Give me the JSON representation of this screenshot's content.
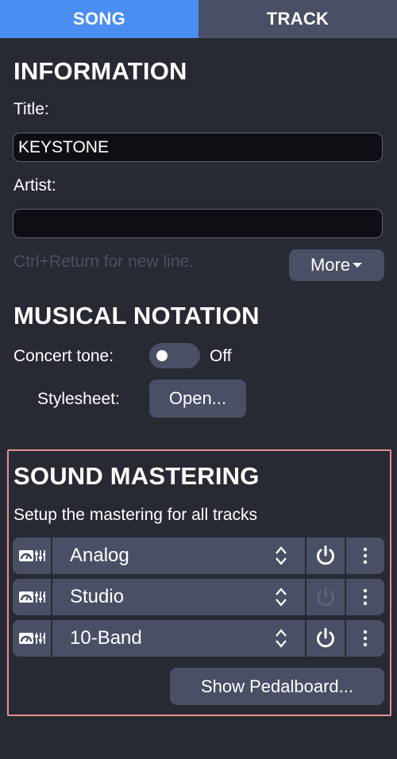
{
  "tabs": [
    {
      "label": "SONG",
      "active": true
    },
    {
      "label": "TRACK",
      "active": false
    }
  ],
  "information": {
    "heading": "INFORMATION",
    "title_label": "Title:",
    "title_value": "KEYSTONE",
    "artist_label": "Artist:",
    "artist_value": "",
    "hint": "Ctrl+Return for new line.",
    "more_label": "More"
  },
  "notation": {
    "heading": "MUSICAL NOTATION",
    "concert_tone_label": "Concert tone:",
    "concert_tone_state": "Off",
    "stylesheet_label": "Stylesheet:",
    "open_label": "Open..."
  },
  "mastering": {
    "heading": "SOUND MASTERING",
    "description": "Setup the mastering for all tracks",
    "chains": [
      {
        "name": "Analog",
        "enabled": true
      },
      {
        "name": "Studio",
        "enabled": false
      },
      {
        "name": "10-Band",
        "enabled": true
      }
    ],
    "pedalboard_label": "Show Pedalboard..."
  },
  "colors": {
    "background": "#272a33",
    "accent": "#4b8ef2",
    "control": "#4a4f65",
    "highlight_border": "#e58f92"
  },
  "icons": {
    "amp": "amp-eq-icon",
    "power": "power-icon",
    "menu": "more-vertical-icon",
    "updown": "chevron-up-down-icon",
    "dropdown": "triangle-down-icon"
  }
}
